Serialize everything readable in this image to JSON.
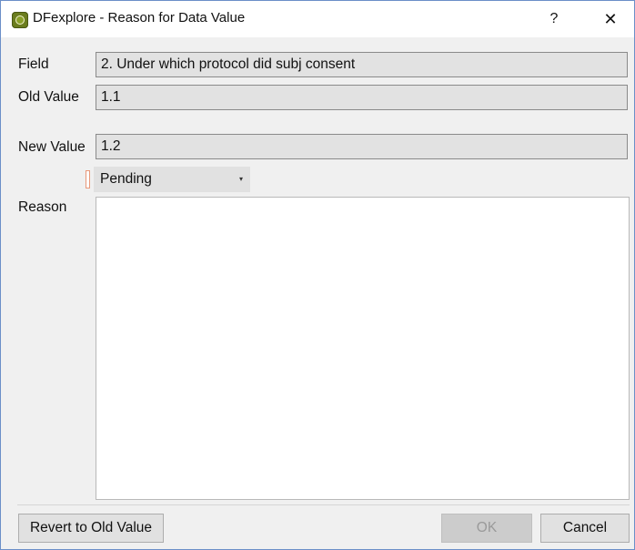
{
  "window": {
    "title": "DFexplore - Reason for Data Value",
    "help_glyph": "?",
    "close_glyph": "✕",
    "app_icon": "dfexplore-app-icon"
  },
  "form": {
    "field_label": "Field",
    "field_value": "2. Under which protocol did subj consent",
    "old_value_label": "Old Value",
    "old_value": "1.1",
    "new_value_label": "New Value",
    "new_value": "1.2",
    "status_selected": "Pending",
    "status_arrow": "▾",
    "reason_label": "Reason",
    "reason_text": ""
  },
  "buttons": {
    "revert_label": "Revert to Old Value",
    "ok_label": "OK",
    "cancel_label": "Cancel"
  },
  "colors": {
    "status_marker": "#e8987a",
    "window_border": "#6b8fc8"
  }
}
